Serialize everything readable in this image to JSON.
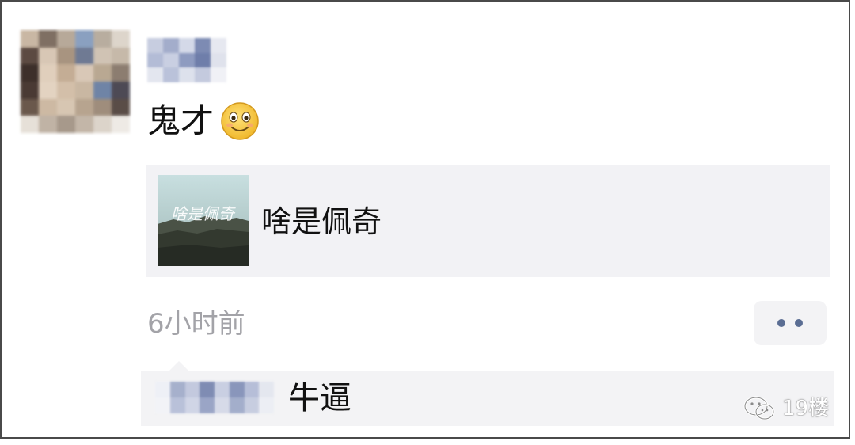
{
  "post": {
    "text": "鬼才",
    "emoji": "smile-emoji"
  },
  "share": {
    "thumb_text": "啥是佩奇",
    "title": "啥是佩奇"
  },
  "meta": {
    "timestamp": "6小时前",
    "more_icon": "ellipsis-icon"
  },
  "comment": {
    "text": "牛逼"
  },
  "watermark": {
    "text": "19楼",
    "icon": "wechat-icon"
  },
  "colors": {
    "link_blue": "#5a6d93",
    "card_bg": "#f2f2f5",
    "timestamp_gray": "#a3a3a8"
  }
}
